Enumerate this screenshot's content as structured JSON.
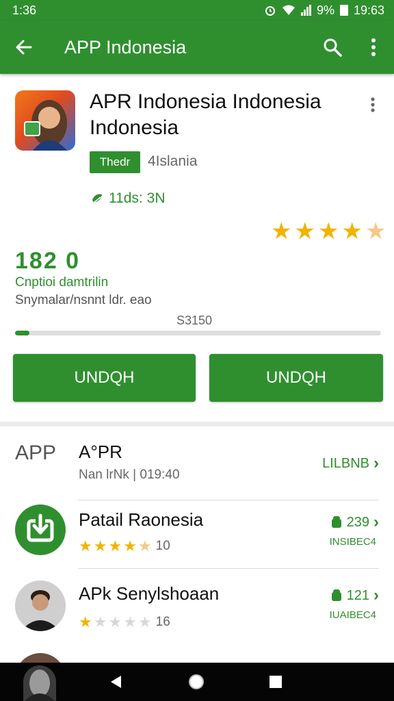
{
  "status_bar": {
    "time": "1:36",
    "battery_text": "9%",
    "right_text": "19:63"
  },
  "app_bar": {
    "title": "APP Indonesia"
  },
  "app": {
    "name": "APR Indonesia Indonesia Indonesia",
    "badge": "Thedr",
    "developer": "4Islania",
    "downloads": "11ds: 3N",
    "stars": 4.5,
    "rating_number": "182 0",
    "rating_label": "Cnptioi damtrilin",
    "rating_sub": "Snymalar/nsnnt ldr. eao",
    "progress_text": "S3150",
    "progress_fraction": 0.04
  },
  "buttons": {
    "left": "UNDQH",
    "right": "UNDQH"
  },
  "list": [
    {
      "lead_text": "APP",
      "title": "A°PR",
      "subtitle": "Nan lrNk | 019:40",
      "right_top": "LILBNB",
      "right_bottom": ""
    },
    {
      "title": "Patail Raonesia",
      "stars": 4.5,
      "star_count": "10",
      "right_top": "239",
      "right_bottom": "INSIBEC4"
    },
    {
      "title": "APk Senylshoaan",
      "stars": 1,
      "star_count": "16",
      "right_top": "121",
      "right_bottom": "IUAIBEC4"
    }
  ],
  "colors": {
    "primary": "#2f8f2f",
    "star": "#f0b400",
    "nav": "#050505"
  },
  "icons": [
    "back-arrow-icon",
    "search-icon",
    "more-vert-icon",
    "download-icon",
    "chevron-right-icon",
    "back-triangle-icon",
    "home-circle-icon",
    "recents-square-icon"
  ]
}
